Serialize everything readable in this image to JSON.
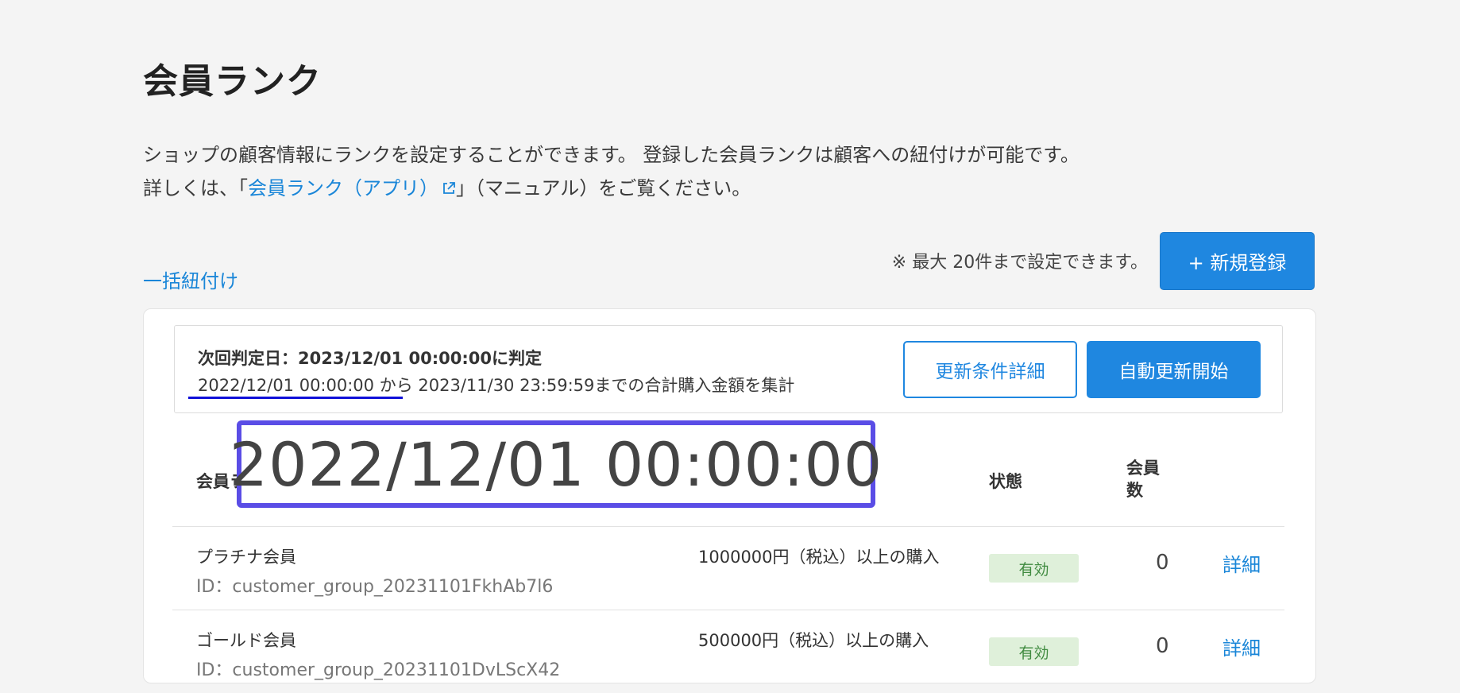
{
  "page": {
    "title": "会員ランク",
    "description_line1": "ショップの顧客情報にランクを設定することができます。 登録した会員ランクは顧客への紐付けが可能です。",
    "description_prefix": "詳しくは、「",
    "manual_link": "会員ランク（アプリ）",
    "description_suffix": "」（マニュアル）をご覧ください。"
  },
  "actions": {
    "bulk_link": "一括紐付け",
    "limit_note": "※ 最大 20件まで設定できます。",
    "new_button_label": "+ 新規登録"
  },
  "judgement": {
    "line1": "次回判定日：2023/12/01 00:00:00に判定",
    "line2": "2022/12/01 00:00:00 から 2023/11/30 23:59:59までの合計購入金額を集計",
    "detail_button": "更新条件詳細",
    "auto_button": "自動更新開始"
  },
  "zoom_callout": "2022/12/01 00:00:00",
  "table": {
    "headers": {
      "name": "会員ラ",
      "status": "状態",
      "count": "会員数"
    },
    "rows": [
      {
        "name": "プラチナ会員",
        "id": "ID：customer_group_20231101FkhAb7l6",
        "condition": "1000000円（税込）以上の購入",
        "status": "有効",
        "count": "0",
        "detail": "詳細"
      },
      {
        "name": "ゴールド会員",
        "id": "ID：customer_group_20231101DvLScX42",
        "condition": "500000円（税込）以上の購入",
        "status": "有効",
        "count": "0",
        "detail": "詳細"
      }
    ]
  },
  "colors": {
    "link": "#1a86d8",
    "primary": "#1f87e0",
    "badge_bg": "#dff0da",
    "callout_border": "#5a4de6",
    "underline": "#1010d8"
  },
  "icons": {
    "external_link": "external-link-icon"
  }
}
